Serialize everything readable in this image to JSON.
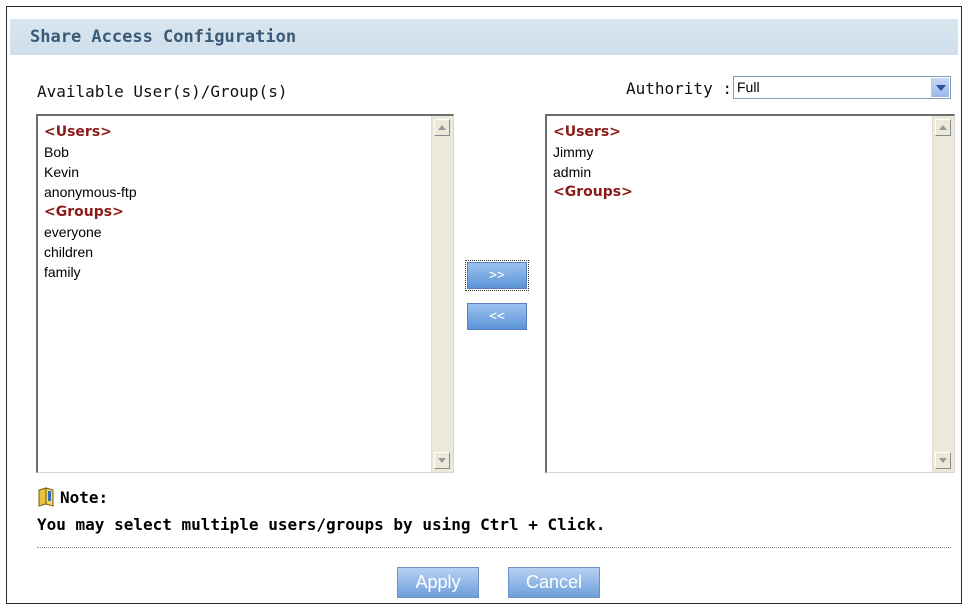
{
  "title": "Share Access Configuration",
  "available_label": "Available User(s)/Group(s)",
  "authority": {
    "label": "Authority :",
    "value": "Full"
  },
  "available_list": [
    {
      "text": "<Users>",
      "header": true
    },
    {
      "text": "Bob",
      "header": false
    },
    {
      "text": "Kevin",
      "header": false
    },
    {
      "text": "anonymous-ftp",
      "header": false
    },
    {
      "text": "<Groups>",
      "header": true
    },
    {
      "text": "everyone",
      "header": false
    },
    {
      "text": "children",
      "header": false
    },
    {
      "text": "family",
      "header": false
    }
  ],
  "selected_list": [
    {
      "text": "<Users>",
      "header": true
    },
    {
      "text": "Jimmy",
      "header": false
    },
    {
      "text": "admin",
      "header": false
    },
    {
      "text": "<Groups>",
      "header": true
    }
  ],
  "buttons": {
    "add": ">>",
    "remove": "<<",
    "apply": "Apply",
    "cancel": "Cancel"
  },
  "note": {
    "label": "Note:",
    "text": "You may select multiple users/groups by using Ctrl + Click.",
    "icon": "note-icon"
  },
  "colors": {
    "header_text": "#8b1a1a",
    "title_text": "#3a5a78",
    "title_bg": "#d9e6f0",
    "button": "#6e9fdc"
  }
}
